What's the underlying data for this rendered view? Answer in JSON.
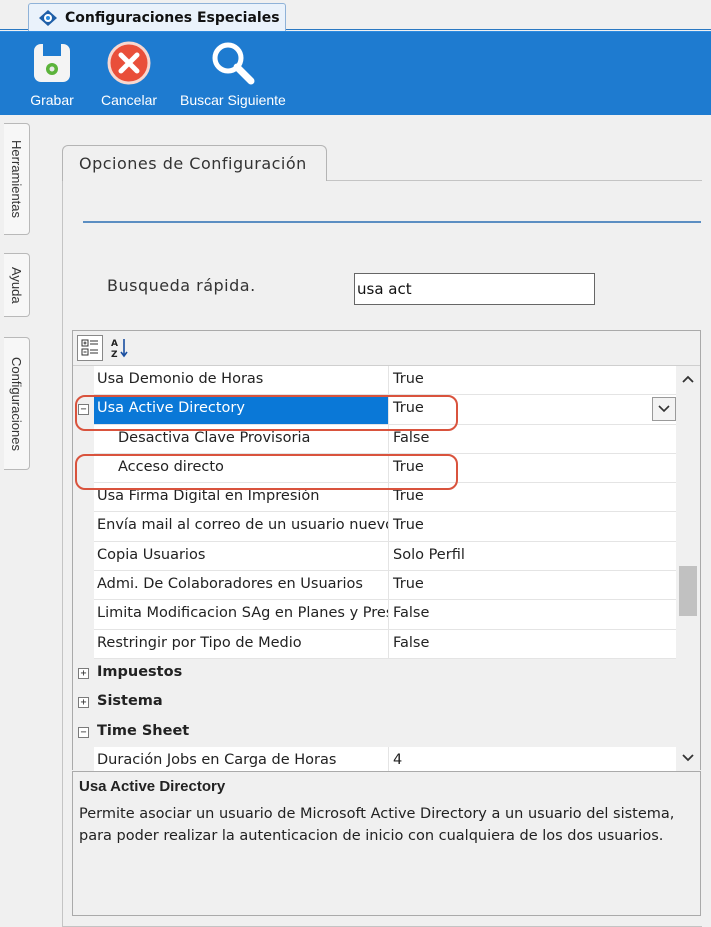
{
  "window": {
    "tab_title": "Configuraciones Especiales"
  },
  "toolbar": {
    "buttons": [
      {
        "label": "Grabar",
        "icon": "save-icon"
      },
      {
        "label": "Cancelar",
        "icon": "cancel-icon"
      },
      {
        "label": "Buscar Siguiente",
        "icon": "search-icon"
      }
    ]
  },
  "side_tabs": [
    "Herramientas",
    "Ayuda",
    "Configuraciones"
  ],
  "panel": {
    "tab_label": "Opciones de Configuración",
    "quick_search": {
      "label": "Busqueda rápida.",
      "value": "usa act"
    }
  },
  "property_grid": {
    "rows": [
      {
        "type": "prop",
        "name": "Usa Demonio de Horas",
        "value": "True"
      },
      {
        "type": "prop",
        "name": "Usa Active Directory",
        "value": "True",
        "selected": true,
        "expander": "−"
      },
      {
        "type": "sub",
        "name": "Desactiva Clave Provisoria",
        "value": "False"
      },
      {
        "type": "sub",
        "name": "Acceso directo",
        "value": "True"
      },
      {
        "type": "prop",
        "name": "Usa Firma Digital en Impresión",
        "value": "True"
      },
      {
        "type": "prop",
        "name": "Envía mail al correo de un usuario nuevo",
        "value": "True"
      },
      {
        "type": "prop",
        "name": "Copia Usuarios",
        "value": "Solo Perfil"
      },
      {
        "type": "prop",
        "name": "Admi. De Colaboradores en Usuarios",
        "value": "True"
      },
      {
        "type": "prop",
        "name": "Limita Modificacion SAg en Planes y Presupuestos",
        "value": "False"
      },
      {
        "type": "prop",
        "name": "Restringir por Tipo de Medio",
        "value": "False"
      },
      {
        "type": "cat",
        "name": "Impuestos",
        "expander": "+"
      },
      {
        "type": "cat",
        "name": "Sistema",
        "expander": "+"
      },
      {
        "type": "cat",
        "name": "Time Sheet",
        "expander": "−"
      },
      {
        "type": "prop",
        "name": "Duración Jobs en Carga de Horas",
        "value": "4"
      }
    ]
  },
  "description": {
    "title": "Usa Active Directory",
    "text": "Permite asociar un usuario de Microsoft Active Directory a un usuario del sistema, para poder realizar la autenticacion de inicio con cualquiera de los dos usuarios."
  },
  "colors": {
    "toolbar": "#1e7bd0",
    "selection": "#0a78d7",
    "highlight": "#d9533d"
  }
}
